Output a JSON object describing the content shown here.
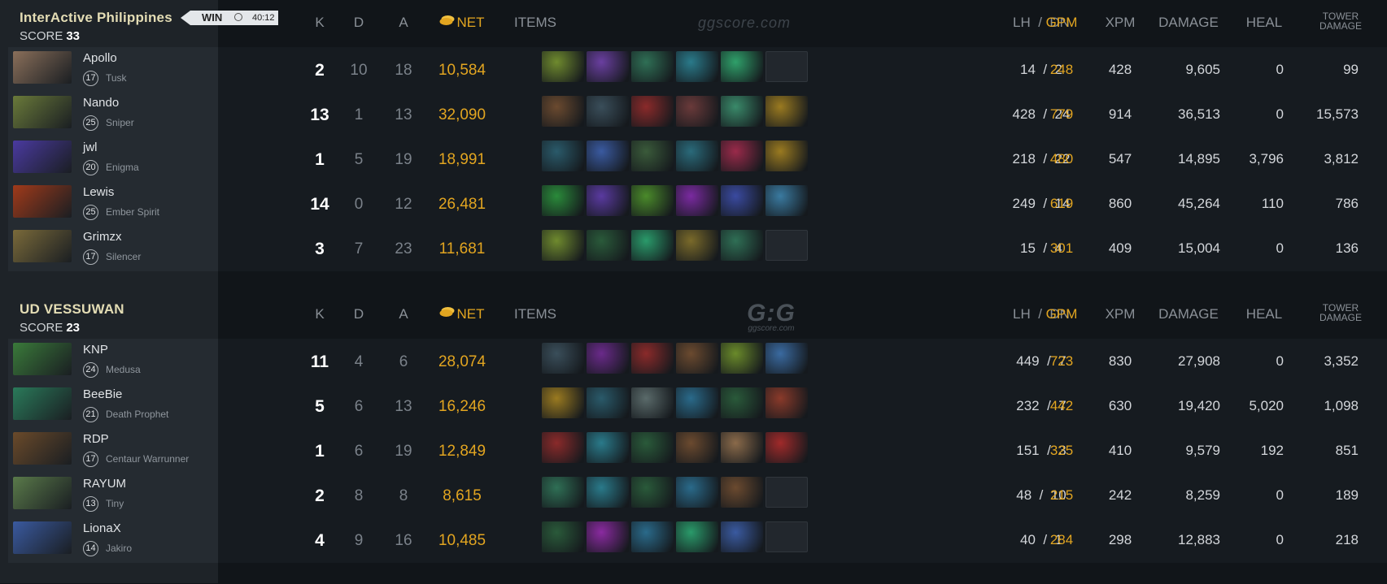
{
  "teams": [
    {
      "name": "InterActive Philippines",
      "score_label": "SCORE",
      "score": "33",
      "result": "WIN",
      "duration": "40:12",
      "watermark": "ggscore.com",
      "players": [
        {
          "name": "Apollo",
          "level": "17",
          "hero": "Tusk",
          "k": "2",
          "d": "10",
          "a": "18",
          "net": "10,584",
          "lh": "14",
          "dn": "2",
          "gpm": "248",
          "xpm": "428",
          "damage": "9,605",
          "heal": "0",
          "tower": "99",
          "portrait_color": "#8a6f5a",
          "items": [
            "#6f8a2e",
            "#6a3fa0",
            "#2f6f55",
            "#2a7a8a",
            "#2fa06a",
            "empty"
          ]
        },
        {
          "name": "Nando",
          "level": "25",
          "hero": "Sniper",
          "k": "13",
          "d": "1",
          "a": "13",
          "net": "32,090",
          "lh": "428",
          "dn": "24",
          "gpm": "779",
          "xpm": "914",
          "damage": "36,513",
          "heal": "0",
          "tower": "15,573",
          "portrait_color": "#6a7a3a",
          "items": [
            "#6b4a2f",
            "#3a4e5a",
            "#8a2a2a",
            "#6a3a3a",
            "#3a8a6a",
            "#9a7a20"
          ]
        },
        {
          "name": "jwl",
          "level": "20",
          "hero": "Enigma",
          "k": "1",
          "d": "5",
          "a": "19",
          "net": "18,991",
          "lh": "218",
          "dn": "22",
          "gpm": "480",
          "xpm": "547",
          "damage": "14,895",
          "heal": "3,796",
          "tower": "3,812",
          "portrait_color": "#4a3aa0",
          "items": [
            "#2a5a6a",
            "#3a5aa0",
            "#3a5a3a",
            "#2a6a7a",
            "#9a2a4a",
            "#9a7a20"
          ]
        },
        {
          "name": "Lewis",
          "level": "25",
          "hero": "Ember Spirit",
          "k": "14",
          "d": "0",
          "a": "12",
          "net": "26,481",
          "lh": "249",
          "dn": "14",
          "gpm": "619",
          "xpm": "860",
          "damage": "45,264",
          "heal": "110",
          "tower": "786",
          "portrait_color": "#a03a1a",
          "items": [
            "#2a8a3a",
            "#5a3aa0",
            "#4a8a2a",
            "#7a2aa0",
            "#3a4aa0",
            "#3a7aa0"
          ]
        },
        {
          "name": "Grimzx",
          "level": "17",
          "hero": "Silencer",
          "k": "3",
          "d": "7",
          "a": "23",
          "net": "11,681",
          "lh": "15",
          "dn": "4",
          "gpm": "301",
          "xpm": "409",
          "damage": "15,004",
          "heal": "0",
          "tower": "136",
          "portrait_color": "#7a6a3a",
          "items": [
            "#6f8a2e",
            "#2a5a3a",
            "#2a9a6a",
            "#7a6a2a",
            "#2f6f55",
            "empty"
          ]
        }
      ]
    },
    {
      "name": "UD VESSUWAN",
      "score_label": "SCORE",
      "score": "23",
      "watermark_big": "G:G",
      "watermark_small": "ggscore.com",
      "players": [
        {
          "name": "KNP",
          "level": "24",
          "hero": "Medusa",
          "k": "11",
          "d": "4",
          "a": "6",
          "net": "28,074",
          "lh": "449",
          "dn": "7",
          "gpm": "723",
          "xpm": "830",
          "damage": "27,908",
          "heal": "0",
          "tower": "3,352",
          "portrait_color": "#3a7a3a",
          "items": [
            "#3a4e5a",
            "#6a2a8a",
            "#8a2a2a",
            "#6b4a2f",
            "#6a8a2a",
            "#3a6aa0"
          ]
        },
        {
          "name": "BeeBie",
          "level": "21",
          "hero": "Death Prophet",
          "k": "5",
          "d": "6",
          "a": "13",
          "net": "16,246",
          "lh": "232",
          "dn": "7",
          "gpm": "442",
          "xpm": "630",
          "damage": "19,420",
          "heal": "5,020",
          "tower": "1,098",
          "portrait_color": "#2a7a5a",
          "items": [
            "#9a7a20",
            "#2a5a6a",
            "#5a6a6a",
            "#2a6a8a",
            "#2a5a3a",
            "#8a3a2a"
          ]
        },
        {
          "name": "RDP",
          "level": "17",
          "hero": "Centaur Warrunner",
          "k": "1",
          "d": "6",
          "a": "19",
          "net": "12,849",
          "lh": "151",
          "dn": "3",
          "gpm": "325",
          "xpm": "410",
          "damage": "9,579",
          "heal": "192",
          "tower": "851",
          "portrait_color": "#6a4a2a",
          "items": [
            "#8a2a2a",
            "#2a7a8a",
            "#2a5a3a",
            "#6b4a2f",
            "#8a6a4a",
            "#a02a2a"
          ]
        },
        {
          "name": "RAYUM",
          "level": "13",
          "hero": "Tiny",
          "k": "2",
          "d": "8",
          "a": "8",
          "net": "8,615",
          "lh": "48",
          "dn": "10",
          "gpm": "215",
          "xpm": "242",
          "damage": "8,259",
          "heal": "0",
          "tower": "189",
          "portrait_color": "#5a7a4a",
          "items": [
            "#2f6f55",
            "#2a7a8a",
            "#2a5a3a",
            "#2a6a8a",
            "#6b4a2f",
            "empty"
          ]
        },
        {
          "name": "LionaX",
          "level": "14",
          "hero": "Jakiro",
          "k": "4",
          "d": "9",
          "a": "16",
          "net": "10,485",
          "lh": "40",
          "dn": "1",
          "gpm": "284",
          "xpm": "298",
          "damage": "12,883",
          "heal": "0",
          "tower": "218",
          "portrait_color": "#3a5aa0",
          "items": [
            "#2a5a3a",
            "#8a2aa0",
            "#2a6a8a",
            "#2a9a6a",
            "#3a5aa0",
            "empty"
          ]
        }
      ]
    }
  ],
  "columns": {
    "k": "K",
    "d": "D",
    "a": "A",
    "net": "NET",
    "items": "ITEMS",
    "lhdn": "LH  /  DN",
    "gpm": "GPM",
    "xpm": "XPM",
    "damage": "DAMAGE",
    "heal": "HEAL",
    "tower_line1": "TOWER",
    "tower_line2": "DAMAGE"
  }
}
